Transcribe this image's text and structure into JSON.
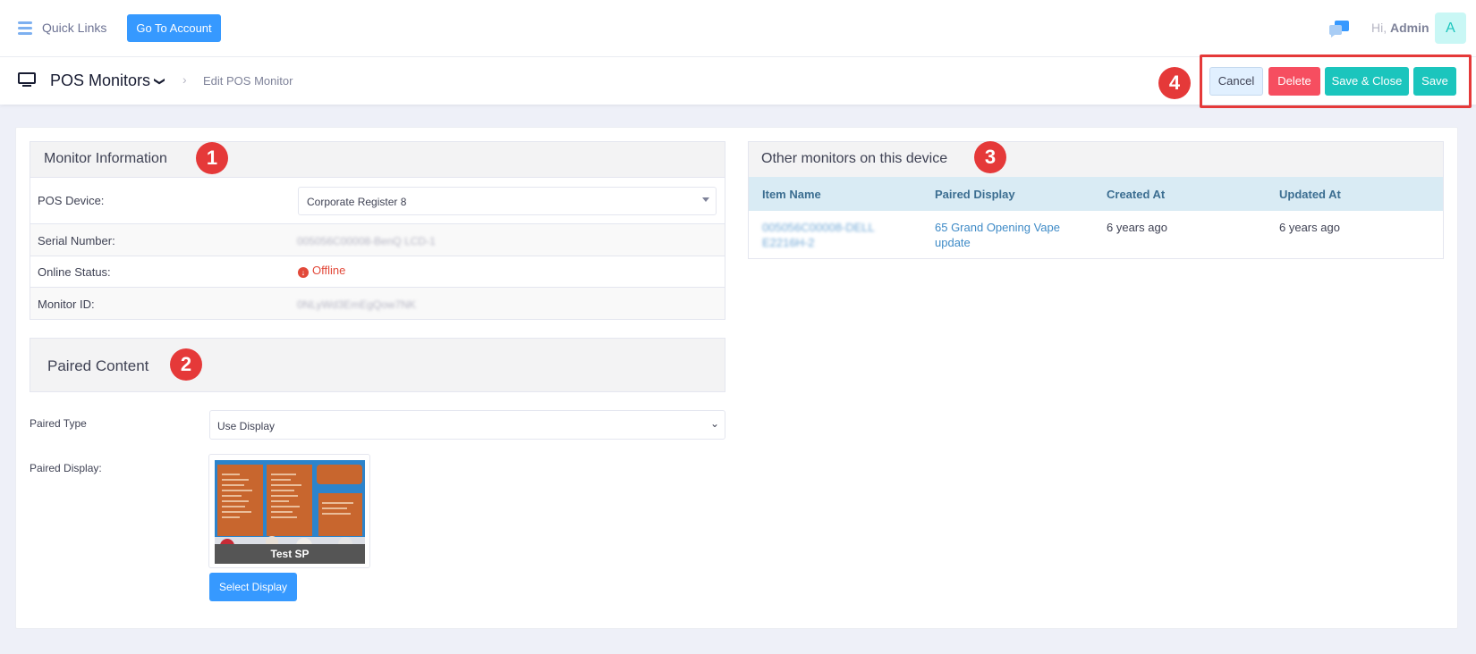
{
  "topbar": {
    "quick_links": "Quick Links",
    "goto_account": "Go To Account",
    "greeting_prefix": "Hi,",
    "user_name": "Admin",
    "avatar_letter": "A"
  },
  "subheader": {
    "title": "POS Monitors",
    "breadcrumb": "Edit POS Monitor",
    "actions": {
      "cancel": "Cancel",
      "delete": "Delete",
      "save_close": "Save & Close",
      "save": "Save"
    }
  },
  "annotations": [
    "1",
    "2",
    "3",
    "4"
  ],
  "monitor_info": {
    "title": "Monitor Information",
    "pos_device_label": "POS Device:",
    "pos_device_value": "Corporate Register 8",
    "serial_label": "Serial Number:",
    "serial_value": "005056C00008-BenQ LCD-1",
    "online_label": "Online Status:",
    "online_value": "Offline",
    "monitor_id_label": "Monitor ID:",
    "monitor_id_value": "0NLyWd3EmEgQow7NK"
  },
  "paired_content": {
    "title": "Paired Content",
    "type_label": "Paired Type",
    "type_value": "Use Display",
    "display_label": "Paired Display:",
    "display_name": "Test SP",
    "select_button": "Select Display"
  },
  "other_monitors": {
    "title": "Other monitors on this device",
    "columns": [
      "Item Name",
      "Paired Display",
      "Created At",
      "Updated At"
    ],
    "rows": [
      {
        "item_name": "005056C00008-DELL E2216H-2",
        "paired_display": "65 Grand Opening Vape update",
        "created_at": "6 years ago",
        "updated_at": "6 years ago"
      }
    ]
  },
  "colors": {
    "primary": "#3699ff",
    "danger": "#f64e60",
    "success": "#1bc5bd",
    "annotation": "#e53939"
  }
}
